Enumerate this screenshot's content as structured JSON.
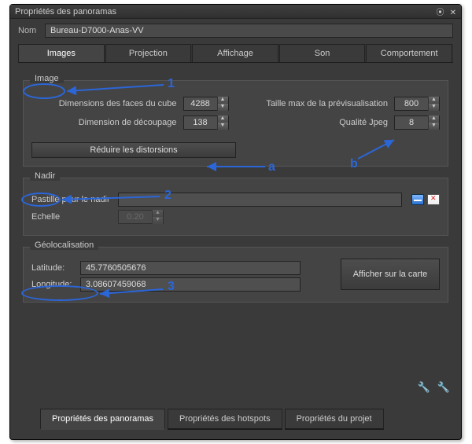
{
  "window": {
    "title": "Propriétés des panoramas",
    "pin_icon": "pin-icon",
    "close_icon": "close-icon"
  },
  "name_row": {
    "label": "Nom",
    "value": "Bureau-D7000-Anas-VV"
  },
  "tabs_top": [
    {
      "label": "Images",
      "active": true
    },
    {
      "label": "Projection"
    },
    {
      "label": "Affichage"
    },
    {
      "label": "Son"
    },
    {
      "label": "Comportement"
    }
  ],
  "group_image": {
    "legend": "Image",
    "face_dim_label": "Dimensions des faces du cube",
    "face_dim_value": "4288",
    "cut_dim_label": "Dimension de découpage",
    "cut_dim_value": "138",
    "preview_label": "Taille max de la prévisualisation",
    "preview_value": "800",
    "jpeg_label": "Qualité Jpeg",
    "jpeg_value": "8",
    "reduce_btn": "Réduire les distorsions"
  },
  "group_nadir": {
    "legend": "Nadir",
    "patch_label": "Pastille pour le nadir",
    "scale_label": "Echelle",
    "scale_value": "0.20"
  },
  "group_geo": {
    "legend": "Géolocalisation",
    "lat_label": "Latitude:",
    "lat_value": "45.7760505676",
    "lon_label": "Longitude:",
    "lon_value": "3.08607459068",
    "map_btn": "Afficher sur la carte"
  },
  "tabs_bottom": [
    {
      "label": "Propriétés des panoramas",
      "active": true
    },
    {
      "label": "Propriétés des hotspots"
    },
    {
      "label": "Propriétés du projet"
    }
  ],
  "annotations": {
    "n1": "1",
    "n2": "2",
    "n3": "3",
    "a": "a",
    "b": "b"
  }
}
